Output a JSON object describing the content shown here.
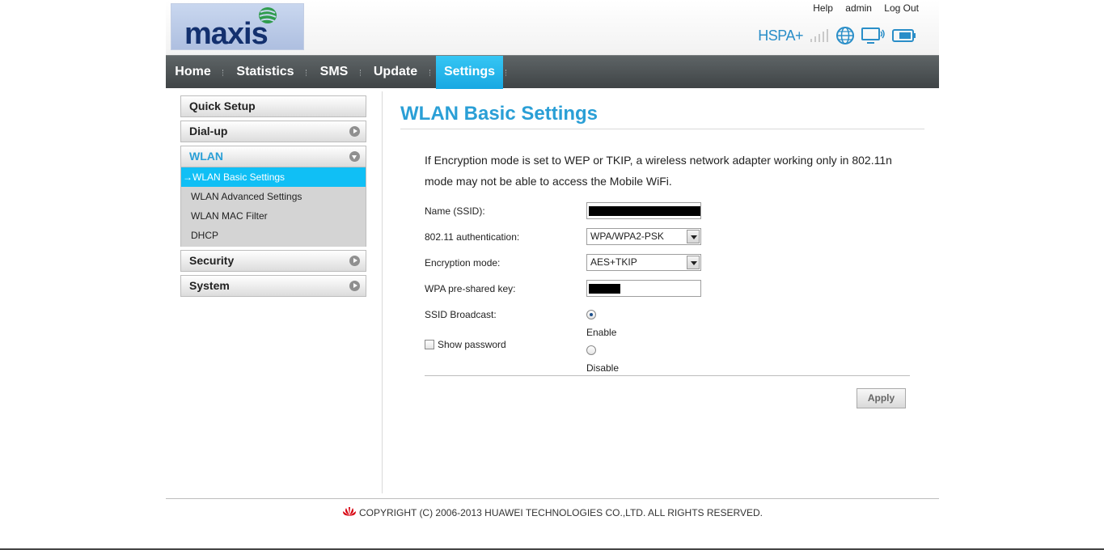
{
  "brand": {
    "logo_text": "maxis",
    "network_type": "HSPA+",
    "accent_color": "#2a9fd6",
    "nav_active_color": "#18a8e2"
  },
  "top_links": {
    "help": "Help",
    "user": "admin",
    "logout": "Log Out"
  },
  "status_icons": [
    "signal-bars-icon",
    "globe-icon",
    "wifi-monitor-icon",
    "battery-icon"
  ],
  "nav": {
    "items": [
      {
        "label": "Home"
      },
      {
        "label": "Statistics"
      },
      {
        "label": "SMS"
      },
      {
        "label": "Update"
      },
      {
        "label": "Settings",
        "active": true
      }
    ]
  },
  "sidebar": {
    "quick_setup": "Quick Setup",
    "dialup": "Dial-up",
    "wlan": "WLAN",
    "wlan_items": [
      {
        "label": "→WLAN Basic Settings",
        "active": true
      },
      {
        "label": "WLAN Advanced Settings"
      },
      {
        "label": "WLAN MAC Filter"
      },
      {
        "label": "DHCP"
      }
    ],
    "security": "Security",
    "system": "System"
  },
  "main": {
    "title": "WLAN Basic Settings",
    "info": "If Encryption mode is set to WEP or TKIP, a wireless network adapter working only in 802.11n mode may not be able to access the Mobile WiFi.",
    "form": {
      "ssid_label": "Name (SSID):",
      "auth_label": "802.11 authentication:",
      "auth_value": "WPA/WPA2-PSK",
      "enc_label": "Encryption mode:",
      "enc_value": "AES+TKIP",
      "psk_label": "WPA pre-shared key:",
      "broadcast_label": "SSID Broadcast:",
      "enable_label": "Enable",
      "disable_label": "Disable",
      "broadcast_value": "Enable",
      "show_password_label": "Show password"
    },
    "apply_label": "Apply"
  },
  "footer": {
    "copyright": "COPYRIGHT (C) 2006-2013 HUAWEI TECHNOLOGIES CO.,LTD. ALL RIGHTS RESERVED."
  }
}
